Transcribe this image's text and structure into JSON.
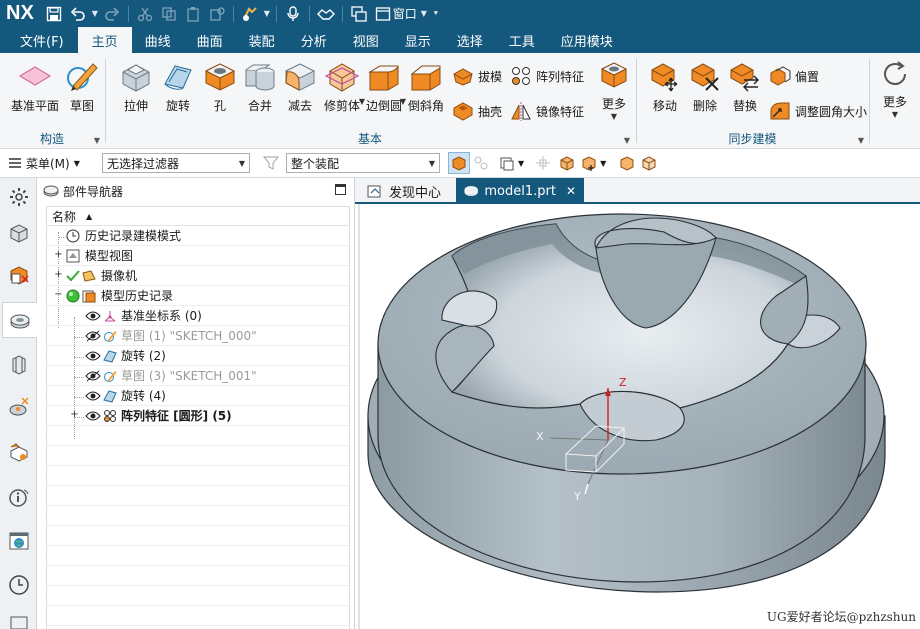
{
  "app": {
    "logo": "NX"
  },
  "quick_access": {
    "window_menu": "窗口"
  },
  "menu_tabs": [
    {
      "label": "文件(F)",
      "active": false
    },
    {
      "label": "主页",
      "active": true
    },
    {
      "label": "曲线",
      "active": false
    },
    {
      "label": "曲面",
      "active": false
    },
    {
      "label": "装配",
      "active": false
    },
    {
      "label": "分析",
      "active": false
    },
    {
      "label": "视图",
      "active": false
    },
    {
      "label": "显示",
      "active": false
    },
    {
      "label": "选择",
      "active": false
    },
    {
      "label": "工具",
      "active": false
    },
    {
      "label": "应用模块",
      "active": false
    }
  ],
  "ribbon": {
    "groups": {
      "construct": "构造",
      "basic": "基本",
      "sync": "同步建模"
    },
    "buttons": {
      "datum_plane": "基准平面",
      "sketch": "草图",
      "extrude": "拉伸",
      "revolve": "旋转",
      "hole": "孔",
      "unite": "合并",
      "subtract": "减去",
      "trim_body": "修剪体",
      "edge_blend": "边倒圆",
      "chamfer": "倒斜角",
      "draft": "拔模",
      "pattern_feature": "阵列特征",
      "shell": "抽壳",
      "mirror_feature": "镜像特征",
      "more_basic": "更多",
      "move": "移动",
      "delete": "删除",
      "replace": "替换",
      "offset": "偏置",
      "resize_blend": "调整圆角大小",
      "more_sync": "更多"
    }
  },
  "filterbar": {
    "menu": "菜单(M)",
    "selection_filter": "无选择过滤器",
    "assembly_scope": "整个装配"
  },
  "navigator": {
    "title": "部件导航器",
    "column_name": "名称",
    "rows": [
      {
        "label": "历史记录建模模式",
        "style": "normal"
      },
      {
        "label": "模型视图",
        "style": "normal"
      },
      {
        "label": "摄像机",
        "style": "normal"
      },
      {
        "label": "模型历史记录",
        "style": "normal"
      },
      {
        "label": "基准坐标系 (0)",
        "style": "normal"
      },
      {
        "label": "草图 (1) \"SKETCH_000\"",
        "style": "dim"
      },
      {
        "label": "旋转 (2)",
        "style": "normal"
      },
      {
        "label": "草图 (3) \"SKETCH_001\"",
        "style": "dim"
      },
      {
        "label": "旋转 (4)",
        "style": "normal"
      },
      {
        "label": "阵列特征 [圆形] (5)",
        "style": "bold"
      }
    ]
  },
  "graphics": {
    "tabs": [
      {
        "label": "发现中心",
        "active": false
      },
      {
        "label": "model1.prt",
        "active": true
      }
    ],
    "triad": {
      "z": "Z",
      "x": "X",
      "y": "Y"
    },
    "watermark": "UG爱好者论坛@pzhzshun"
  },
  "colors": {
    "titlebar": "#14587e",
    "ribbon_bg": "#f4f6f8",
    "icon_orange": "#f08a24",
    "model_gray": "#a7b3bb"
  }
}
